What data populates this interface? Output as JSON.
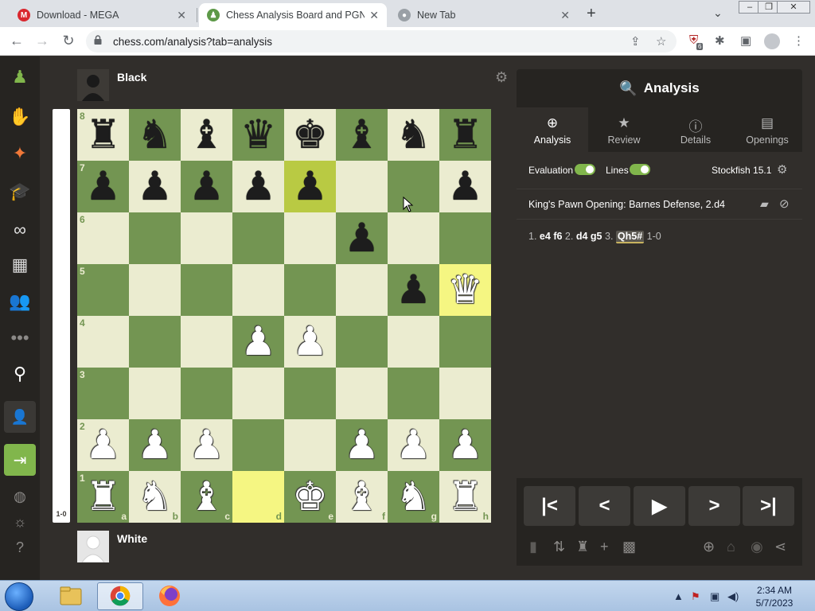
{
  "browser": {
    "tabs": [
      {
        "title": "Download - MEGA",
        "close": "✕"
      },
      {
        "title": "Chess Analysis Board and PGN Ed",
        "close": "✕"
      },
      {
        "title": "New Tab",
        "close": "✕"
      }
    ],
    "new_tab": "+",
    "url": "chess.com/analysis?tab=analysis",
    "extension_badge": "6"
  },
  "players": {
    "top": "Black",
    "bottom": "White"
  },
  "eval_label": "1-0",
  "board": {
    "ranks": [
      "8",
      "7",
      "6",
      "5",
      "4",
      "3",
      "2",
      "1"
    ],
    "files": [
      "a",
      "b",
      "c",
      "d",
      "e",
      "f",
      "g",
      "h"
    ],
    "highlighted_squares": [
      "e7",
      "h5",
      "d1"
    ],
    "rows": [
      [
        "bR",
        "bN",
        "bB",
        "bQ",
        "bK",
        "bB",
        "bN",
        "bR"
      ],
      [
        "bP",
        "bP",
        "bP",
        "bP",
        "bP",
        "",
        "",
        "bP"
      ],
      [
        "",
        "",
        "",
        "",
        "",
        "bP",
        "",
        ""
      ],
      [
        "",
        "",
        "",
        "",
        "",
        "",
        "bP",
        "wQ"
      ],
      [
        "",
        "",
        "",
        "wP",
        "wP",
        "",
        "",
        ""
      ],
      [
        "",
        "",
        "",
        "",
        "",
        "",
        "",
        ""
      ],
      [
        "wP",
        "wP",
        "wP",
        "",
        "",
        "wP",
        "wP",
        "wP"
      ],
      [
        "wR",
        "wN",
        "wB",
        "",
        "wK",
        "wB",
        "wN",
        "wR"
      ]
    ]
  },
  "panel": {
    "title": "Analysis",
    "tabs": [
      {
        "label": "Analysis"
      },
      {
        "label": "Review"
      },
      {
        "label": "Details"
      },
      {
        "label": "Openings"
      }
    ],
    "evaluation_label": "Evaluation",
    "lines_label": "Lines",
    "engine": "Stockfish 15.1",
    "opening": "King's Pawn Opening: Barnes Defense, 2.d4",
    "moves": {
      "n1": "1.",
      "m1w": "e4",
      "m1b": "f6",
      "n2": "2.",
      "m2w": "d4",
      "m2b": "g5",
      "n3": "3.",
      "m3w": "Qh5#",
      "result": "1-0"
    }
  },
  "taskbar": {
    "time": "2:34 AM",
    "date": "5/7/2023"
  }
}
